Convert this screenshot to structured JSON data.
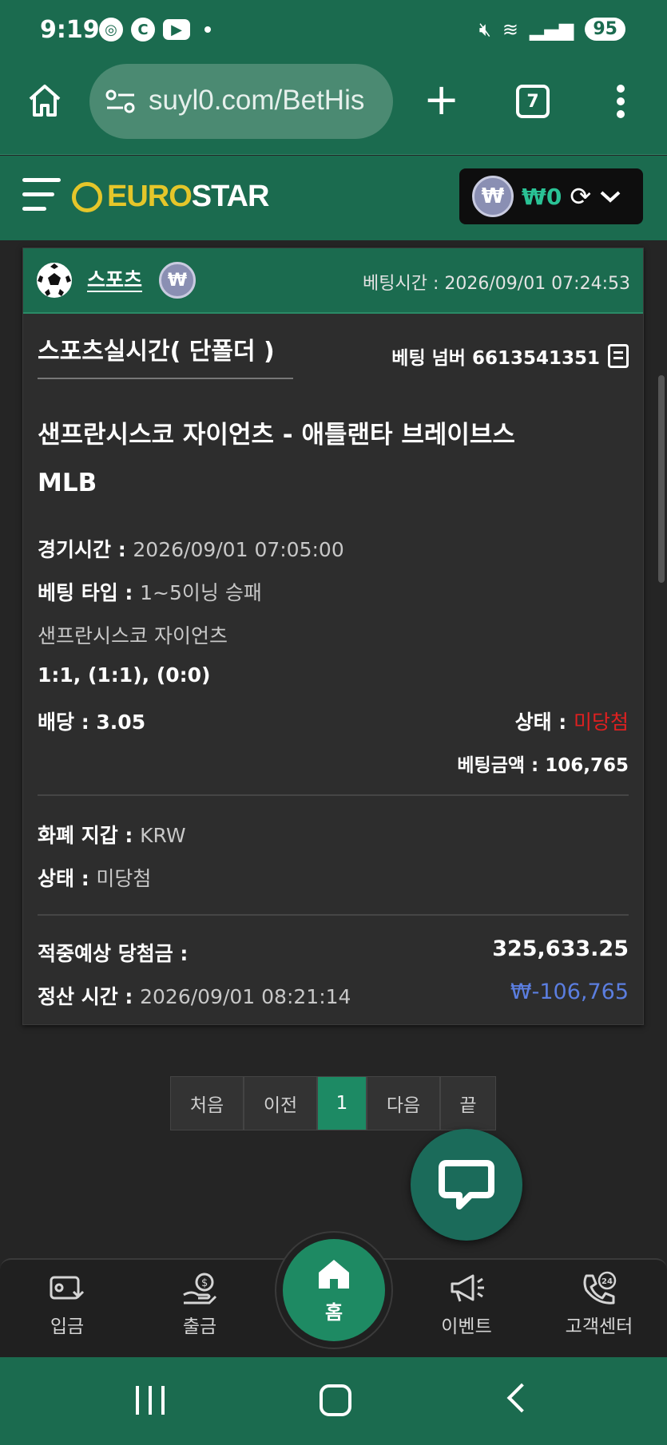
{
  "status_bar": {
    "time": "9:19",
    "battery": "95"
  },
  "browser": {
    "url": "suyl0.com/BetHis",
    "tab_count": "7"
  },
  "site": {
    "logo_part1": "EURO",
    "logo_part2": "STAR",
    "wallet_symbol": "₩",
    "wallet_amount": "₩0"
  },
  "bet": {
    "sport": "스포츠",
    "coin_symbol": "₩",
    "bet_time": "베팅시간 : 2026/09/01 07:24:53",
    "bet_type_title": "스포츠실시간( 단폴더 )",
    "bet_number": "베팅 넘버 6613541351",
    "match": "샌프란시스코 자이언츠 - 애틀랜타 브레이브스",
    "league": "MLB",
    "game_time_label": "경기시간 : ",
    "game_time_value": "2026/09/01 07:05:00",
    "bet_kind_label": "베팅 타입 : ",
    "bet_kind_value": "1~5이닝 승패",
    "pick": "샌프란시스코 자이언츠",
    "score": "1:1, (1:1), (0:0)",
    "odds": "배당 : 3.05",
    "status_label": "상태 : ",
    "status_value": "미당첨",
    "amount": "베팅금액 : 106,765",
    "currency_label": "화폐 지갑 : ",
    "currency_value": "KRW",
    "status2_label": "상태 : ",
    "status2_value": "미당첨",
    "expected_label": "적중예상 당첨금 :",
    "expected_value": "325,633.25",
    "settle_label": "정산 시간 : ",
    "settle_value": "2026/09/01 08:21:14",
    "settle_result": "₩-106,765"
  },
  "pagination": {
    "first": "처음",
    "prev": "이전",
    "current": "1",
    "next": "다음",
    "last": "끝"
  },
  "bottom_nav": {
    "deposit": "입금",
    "withdraw": "출금",
    "home": "홈",
    "event": "이벤트",
    "support": "고객센터"
  },
  "colors": {
    "brand_green": "#1b6b4f",
    "accent_green": "#1e8a63",
    "logo_yellow": "#e5c62a",
    "loss_red": "#e02020",
    "negative_blue": "#5b7ee0"
  },
  "icons": [
    "home-icon",
    "tune-icon",
    "plus-icon",
    "tabs-icon",
    "more-icon",
    "hamburger-icon",
    "won-icon",
    "refresh-icon",
    "chevron-down-icon",
    "soccer-ball-icon",
    "copy-icon",
    "chat-icon",
    "deposit-icon",
    "withdraw-icon",
    "event-megaphone-icon",
    "support-24-icon"
  ]
}
